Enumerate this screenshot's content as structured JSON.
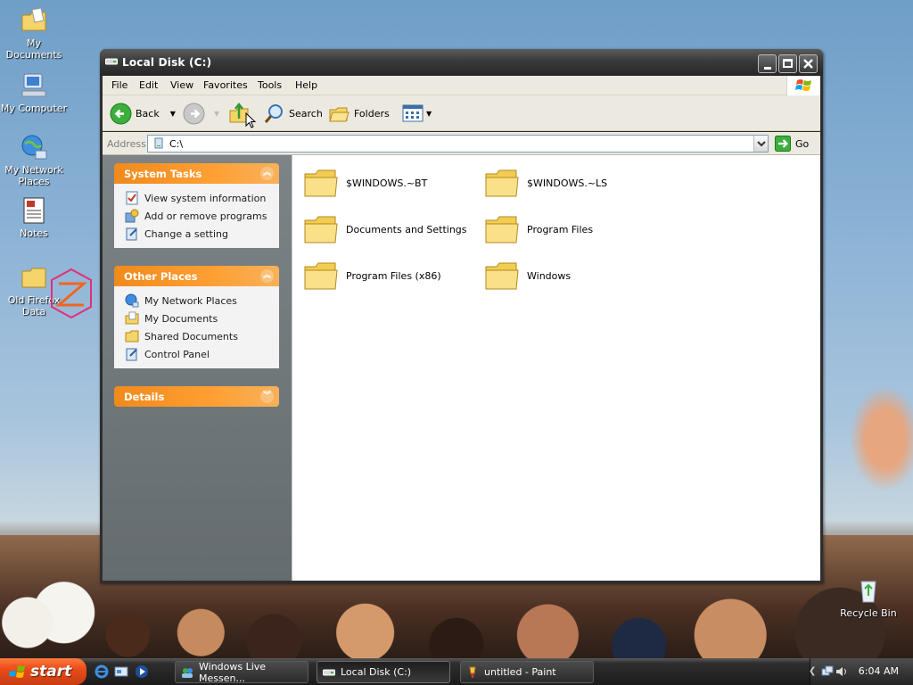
{
  "desktop": {
    "icons": [
      {
        "label": "My Documents"
      },
      {
        "label": "My Computer"
      },
      {
        "label": "My Network Places"
      },
      {
        "label": "Notes"
      },
      {
        "label": "Old Firefox Data"
      },
      {
        "label": "Recycle Bin"
      }
    ]
  },
  "window": {
    "title": "Local Disk (C:)",
    "menu": [
      "File",
      "Edit",
      "View",
      "Favorites",
      "Tools",
      "Help"
    ],
    "toolbar": {
      "back_label": "Back",
      "search_label": "Search",
      "folders_label": "Folders"
    },
    "address": {
      "label": "Address",
      "value": "C:\\",
      "go_label": "Go"
    }
  },
  "taskpane": {
    "system_tasks": {
      "title": "System Tasks",
      "items": [
        "View system information",
        "Add or remove programs",
        "Change a setting"
      ]
    },
    "other_places": {
      "title": "Other Places",
      "items": [
        "My Network Places",
        "My Documents",
        "Shared Documents",
        "Control Panel"
      ]
    },
    "details": {
      "title": "Details"
    }
  },
  "content": {
    "items": [
      {
        "name": "$WINDOWS.~BT"
      },
      {
        "name": "$WINDOWS.~LS"
      },
      {
        "name": "Documents and Settings"
      },
      {
        "name": "Program Files"
      },
      {
        "name": "Program Files (x86)"
      },
      {
        "name": "Windows"
      }
    ]
  },
  "taskbar": {
    "start_label": "start",
    "buttons": [
      {
        "label": "Windows Live Messen..."
      },
      {
        "label": "Local Disk (C:)"
      },
      {
        "label": "untitled - Paint"
      }
    ],
    "clock": "6:04 AM"
  },
  "colors": {
    "panel_header": "#f08a1c",
    "title_bar": "#3a3a3a",
    "task_pane": "#6f777a",
    "start_button": "#e94c1a"
  },
  "icons": {
    "folder": "folder-icon",
    "back": "back-arrow-icon",
    "forward": "forward-arrow-icon",
    "up": "folder-up-icon",
    "search": "magnifier-icon",
    "views": "views-grid-icon"
  }
}
